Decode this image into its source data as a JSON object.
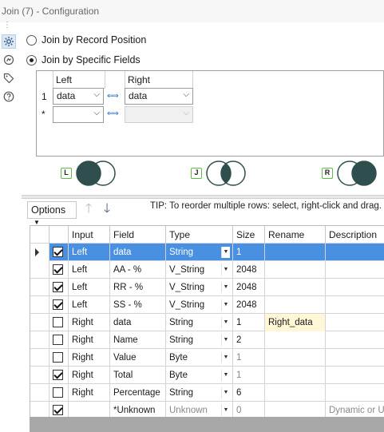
{
  "window": {
    "title": "Join (7) - Configuration"
  },
  "sidebar": {
    "icons": [
      "gear-icon",
      "annotation-icon",
      "tag-icon",
      "help-icon"
    ]
  },
  "join_mode": {
    "option_position": "Join by Record Position",
    "option_fields": "Join by Specific Fields",
    "selected": "Join by Specific Fields"
  },
  "join_fields": {
    "left_header": "Left",
    "right_header": "Right",
    "rows": [
      {
        "num": "1",
        "left": "data",
        "right": "data"
      },
      {
        "num": "*",
        "left": "",
        "right": ""
      }
    ]
  },
  "venn": {
    "left_label": "L",
    "join_label": "J",
    "right_label": "R"
  },
  "toolbar": {
    "options_label": "Options",
    "tip": "TIP: To reorder multiple rows: select, right-click and drag."
  },
  "grid": {
    "headers": [
      "Input",
      "Field",
      "Type",
      "Size",
      "Rename",
      "Description"
    ],
    "rows": [
      {
        "checked": true,
        "input": "Left",
        "field": "data",
        "type": "String",
        "size": "1",
        "rename": "",
        "description": "",
        "selected": true
      },
      {
        "checked": true,
        "input": "Left",
        "field": "AA - %",
        "type": "V_String",
        "size": "2048",
        "rename": "",
        "description": ""
      },
      {
        "checked": true,
        "input": "Left",
        "field": "RR - %",
        "type": "V_String",
        "size": "2048",
        "rename": "",
        "description": ""
      },
      {
        "checked": true,
        "input": "Left",
        "field": "SS - %",
        "type": "V_String",
        "size": "2048",
        "rename": "",
        "description": ""
      },
      {
        "checked": false,
        "input": "Right",
        "field": "data",
        "type": "String",
        "size": "1",
        "rename": "Right_data",
        "description": ""
      },
      {
        "checked": false,
        "input": "Right",
        "field": "Name",
        "type": "String",
        "size": "2",
        "rename": "",
        "description": ""
      },
      {
        "checked": false,
        "input": "Right",
        "field": "Value",
        "type": "Byte",
        "size": "1",
        "rename": "",
        "description": ""
      },
      {
        "checked": true,
        "input": "Right",
        "field": "Total",
        "type": "Byte",
        "size": "1",
        "rename": "",
        "description": ""
      },
      {
        "checked": false,
        "input": "Right",
        "field": "Percentage",
        "type": "String",
        "size": "6",
        "rename": "",
        "description": ""
      },
      {
        "checked": true,
        "input": "",
        "field": "*Unknown",
        "type": "Unknown",
        "size": "0",
        "rename": "",
        "description": "Dynamic or Ur",
        "muted": true
      }
    ]
  },
  "colors": {
    "selection": "#4a90e2",
    "venn_fill": "#2f4f4f",
    "tag_border": "#5bbf3d",
    "swap_arrow": "#2a6fc9"
  }
}
